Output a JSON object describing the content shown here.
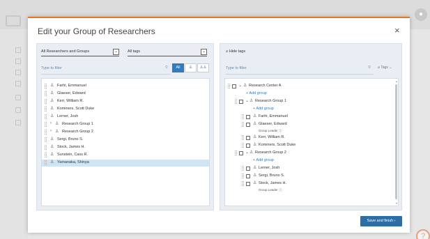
{
  "modal": {
    "title": "Edit your Group of Researchers",
    "close_glyph": "×",
    "save_label": "Save and finish ›"
  },
  "left": {
    "scope_select": "All Researchers and Groups",
    "tags_select": "All tags",
    "filter_placeholder": "Type to filter",
    "seg_all": "All",
    "items": [
      "Farhi, Emmanuel",
      "Glaeser, Edward",
      "Kerr, William R.",
      "Kominers, Scott Duke",
      "Lerner, Josh",
      "Research Group 1",
      "Research Group 2",
      "Sergi, Bruno S.",
      "Stock, James H.",
      "Sunstein, Cass R.",
      "Yamanaka, Shinya"
    ]
  },
  "right": {
    "hide_tags": "Hide tags",
    "filter_placeholder": "Type to filter",
    "tags_label": "Tags",
    "center": "Research Center A",
    "add_group": "+ Add group",
    "group1": "Research Group 1",
    "group2": "Research Group 2",
    "group_leader": "Group Leader",
    "g1_members": [
      "Farhi, Emmanuel",
      "Glaeser, Edward",
      "Kerr, William R.",
      "Kominers, Scott Duke"
    ],
    "g2_members": [
      "Lerner, Josh",
      "Sergi, Bruno S.",
      "Stock, James H."
    ]
  },
  "icons": {
    "person": "person-icon",
    "group": "group-icon",
    "tag": "tag-icon",
    "search": "search-icon"
  },
  "colors": {
    "accent": "#e87722",
    "primary": "#2f7bbf",
    "selected_row": "#cfe5f6"
  }
}
